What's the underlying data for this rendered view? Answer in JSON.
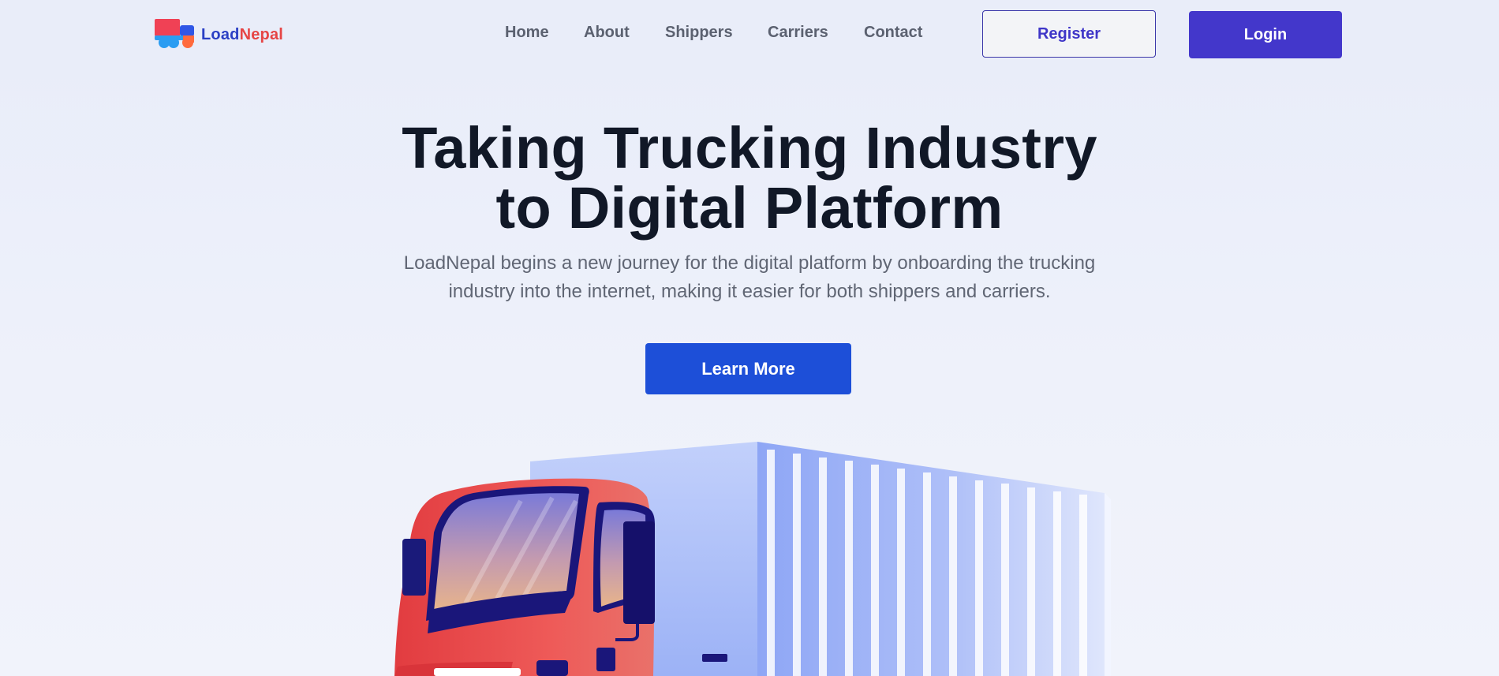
{
  "brand": {
    "name_part1": "Load",
    "name_part2": "Nepal",
    "logo_icon": "truck-logo-icon",
    "colors": {
      "primary": "#2a3fc4",
      "accent": "#e64545"
    }
  },
  "nav": {
    "links": [
      {
        "label": "Home"
      },
      {
        "label": "About"
      },
      {
        "label": "Shippers"
      },
      {
        "label": "Carriers"
      },
      {
        "label": "Contact"
      }
    ],
    "register_label": "Register",
    "login_label": "Login"
  },
  "hero": {
    "title_line1": "Taking Trucking Industry",
    "title_line2": "to Digital Platform",
    "subtitle_line1": "LoadNepal begins a new journey for the digital platform by onboarding the trucking",
    "subtitle_line2": "industry into the internet, making it easier for both shippers and carriers.",
    "cta_label": "Learn More",
    "illustration": "red-truck-illustration"
  },
  "colors": {
    "page_bg": "#e8ecf9",
    "title_text": "#111827",
    "body_text": "#606674",
    "login_bg": "#4337cb",
    "cta_bg": "#1d4fd8",
    "truck_cab": "#e8474a",
    "truck_container": "#9fb4f7"
  }
}
